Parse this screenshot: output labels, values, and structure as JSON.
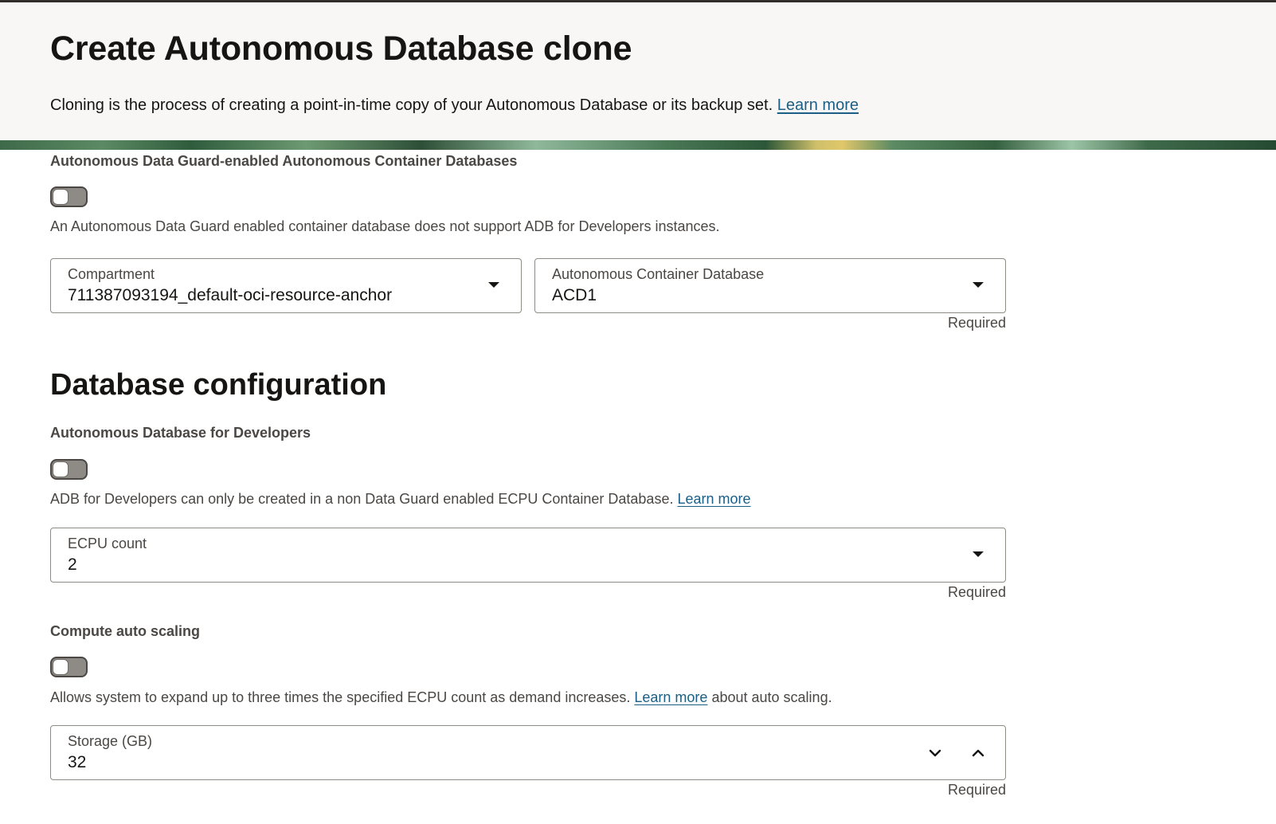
{
  "header": {
    "title": "Create Autonomous Database clone",
    "description": "Cloning is the process of creating a point-in-time copy of your Autonomous Database or its backup set.",
    "learn_more": "Learn more"
  },
  "data_guard": {
    "label": "Autonomous Data Guard-enabled Autonomous Container Databases",
    "toggle_on": false,
    "help": "An Autonomous Data Guard enabled container database does not support ADB for Developers instances."
  },
  "compartment": {
    "label": "Compartment",
    "value": "711387093194_default-oci-resource-anchor"
  },
  "container_db": {
    "label": "Autonomous Container Database",
    "value": "ACD1",
    "required": "Required"
  },
  "db_config": {
    "heading": "Database configuration",
    "developers": {
      "label": "Autonomous Database for Developers",
      "toggle_on": false,
      "help": "ADB for Developers can only be created in a non Data Guard enabled ECPU Container Database.",
      "learn_more": "Learn more"
    },
    "ecpu": {
      "label": "ECPU count",
      "value": "2",
      "required": "Required"
    },
    "auto_scaling": {
      "label": "Compute auto scaling",
      "toggle_on": false,
      "help_prefix": "Allows system to expand up to three times the specified ECPU count as demand increases.",
      "learn_more": "Learn more",
      "help_suffix": "about auto scaling."
    },
    "storage": {
      "label": "Storage (GB)",
      "value": "32",
      "required": "Required"
    }
  },
  "icons": {
    "dropdown": "caret-down-icon",
    "decrement": "chevron-down-icon",
    "increment": "chevron-up-icon"
  },
  "colors": {
    "link": "#1b5e86",
    "header_bg": "#f8f7f5",
    "toggle_off": "#8e8a86"
  }
}
